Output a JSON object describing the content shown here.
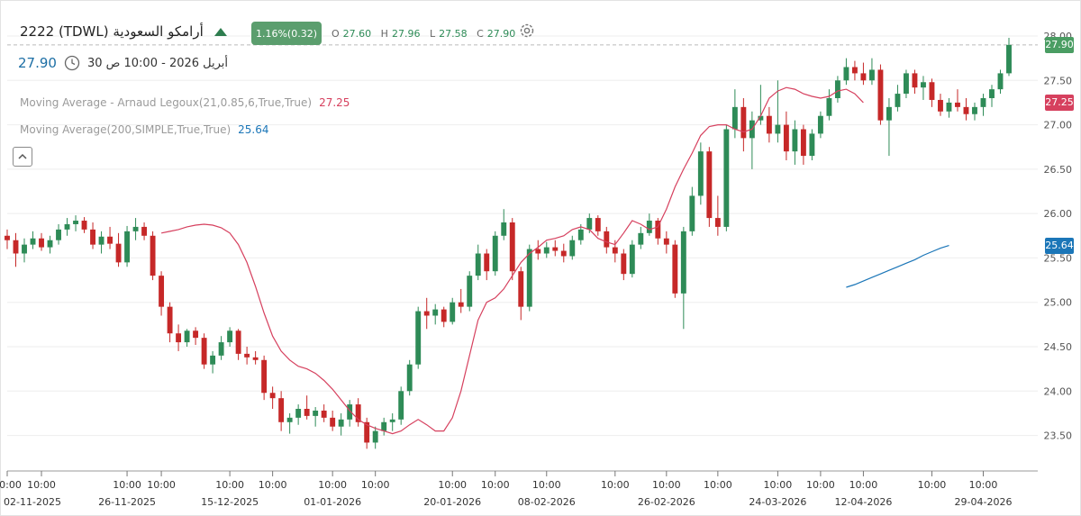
{
  "header": {
    "symbol_label": "2222  (TDWL) أرامكو السعودية",
    "change_badge": "1.16%(0.32)",
    "ohlc": {
      "o_label": "O",
      "o": "27.60",
      "h_label": "H",
      "h": "27.96",
      "l_label": "L",
      "l": "27.58",
      "c_label": "C",
      "c": "27.90"
    },
    "last_price": "27.90",
    "datetime": "30 أبريل 2026 - 10:00 ص",
    "icons": [
      "up-arrow-icon",
      "gear-icon",
      "clock-icon",
      "chevron-up-icon"
    ]
  },
  "indicators": [
    {
      "label": "Moving Average - Arnaud Legoux(21,0.85,6,True,True)",
      "value": "27.25",
      "color": "#d6405e"
    },
    {
      "label": "Moving Average(200,SIMPLE,True,True)",
      "value": "25.64",
      "color": "#1b76b8"
    }
  ],
  "price_tags": {
    "last": "27.90",
    "alma": "27.25",
    "sma": "25.64"
  },
  "colors": {
    "up": "#2e8b57",
    "down": "#c62828",
    "alma": "#d6405e",
    "sma": "#1b76b8",
    "badge": "#5b9e6e"
  },
  "chart_data": {
    "type": "candlestick",
    "ylim": [
      23.1,
      28.0
    ],
    "y_ticks": [
      "23.50",
      "24.00",
      "24.50",
      "25.00",
      "25.50",
      "26.00",
      "26.50",
      "27.00",
      "27.50",
      "28.00"
    ],
    "x_ticks": [
      {
        "time": "10:00",
        "date": "02-11-2025",
        "i": 0
      },
      {
        "time": "10:00",
        "i": 4
      },
      {
        "time": "10:00",
        "date": "26-11-2025",
        "i": 14
      },
      {
        "time": "10:00",
        "i": 18
      },
      {
        "time": "10:00",
        "date": "15-12-2025",
        "i": 26
      },
      {
        "time": "10:00",
        "i": 31
      },
      {
        "time": "10:00",
        "date": "01-01-2026",
        "i": 38
      },
      {
        "time": "10:00",
        "i": 43
      },
      {
        "time": "10:00",
        "date": "20-01-2026",
        "i": 52
      },
      {
        "time": "10:00",
        "i": 57
      },
      {
        "time": "10:00",
        "date": "08-02-2026",
        "i": 63
      },
      {
        "time": "10:00",
        "i": 71
      },
      {
        "time": "10:00",
        "date": "26-02-2026",
        "i": 77
      },
      {
        "time": "10:00",
        "i": 83
      },
      {
        "time": "10:00",
        "date": "24-03-2026",
        "i": 90
      },
      {
        "time": "10:00",
        "i": 95
      },
      {
        "time": "10:00",
        "date": "12-04-2026",
        "i": 100
      },
      {
        "time": "10:00",
        "i": 108
      },
      {
        "time": "10:00",
        "date": "29-04-2026",
        "i": 114
      }
    ],
    "candles": [
      [
        25.75,
        25.82,
        25.6,
        25.7
      ],
      [
        25.7,
        25.78,
        25.4,
        25.55
      ],
      [
        25.55,
        25.72,
        25.45,
        25.65
      ],
      [
        25.65,
        25.8,
        25.6,
        25.72
      ],
      [
        25.72,
        25.78,
        25.58,
        25.62
      ],
      [
        25.62,
        25.75,
        25.55,
        25.7
      ],
      [
        25.7,
        25.88,
        25.65,
        25.82
      ],
      [
        25.82,
        25.95,
        25.75,
        25.88
      ],
      [
        25.88,
        25.98,
        25.8,
        25.92
      ],
      [
        25.92,
        25.96,
        25.78,
        25.82
      ],
      [
        25.82,
        25.9,
        25.6,
        25.65
      ],
      [
        25.65,
        25.8,
        25.55,
        25.74
      ],
      [
        25.74,
        25.85,
        25.6,
        25.66
      ],
      [
        25.66,
        25.78,
        25.4,
        25.45
      ],
      [
        25.45,
        25.86,
        25.4,
        25.8
      ],
      [
        25.8,
        25.95,
        25.7,
        25.85
      ],
      [
        25.85,
        25.9,
        25.7,
        25.75
      ],
      [
        25.75,
        25.8,
        25.25,
        25.3
      ],
      [
        25.3,
        25.35,
        24.85,
        24.95
      ],
      [
        24.95,
        25.0,
        24.55,
        24.65
      ],
      [
        24.65,
        24.75,
        24.45,
        24.55
      ],
      [
        24.55,
        24.7,
        24.5,
        24.68
      ],
      [
        24.68,
        24.72,
        24.52,
        24.6
      ],
      [
        24.6,
        24.65,
        24.25,
        24.3
      ],
      [
        24.3,
        24.45,
        24.2,
        24.4
      ],
      [
        24.4,
        24.62,
        24.35,
        24.55
      ],
      [
        24.55,
        24.72,
        24.5,
        24.68
      ],
      [
        24.68,
        24.7,
        24.35,
        24.42
      ],
      [
        24.42,
        24.5,
        24.3,
        24.38
      ],
      [
        24.38,
        24.45,
        24.3,
        24.35
      ],
      [
        24.35,
        24.4,
        23.9,
        23.98
      ],
      [
        23.98,
        24.05,
        23.8,
        23.92
      ],
      [
        23.92,
        24.0,
        23.55,
        23.65
      ],
      [
        23.65,
        23.75,
        23.52,
        23.7
      ],
      [
        23.7,
        23.85,
        23.62,
        23.8
      ],
      [
        23.8,
        23.95,
        23.68,
        23.72
      ],
      [
        23.72,
        23.82,
        23.6,
        23.78
      ],
      [
        23.78,
        23.85,
        23.65,
        23.7
      ],
      [
        23.7,
        23.78,
        23.55,
        23.6
      ],
      [
        23.6,
        23.75,
        23.5,
        23.68
      ],
      [
        23.68,
        23.9,
        23.6,
        23.85
      ],
      [
        23.85,
        23.92,
        23.6,
        23.65
      ],
      [
        23.65,
        23.7,
        23.35,
        23.42
      ],
      [
        23.42,
        23.6,
        23.35,
        23.55
      ],
      [
        23.55,
        23.7,
        23.5,
        23.65
      ],
      [
        23.65,
        23.75,
        23.55,
        23.68
      ],
      [
        23.68,
        24.05,
        23.62,
        24.0
      ],
      [
        24.0,
        24.35,
        23.95,
        24.3
      ],
      [
        24.3,
        24.95,
        24.25,
        24.9
      ],
      [
        24.9,
        25.05,
        24.7,
        24.85
      ],
      [
        24.85,
        24.98,
        24.75,
        24.92
      ],
      [
        24.92,
        24.95,
        24.72,
        24.78
      ],
      [
        24.78,
        25.05,
        24.75,
        25.0
      ],
      [
        25.0,
        25.15,
        24.88,
        24.95
      ],
      [
        24.95,
        25.35,
        24.9,
        25.3
      ],
      [
        25.3,
        25.65,
        25.25,
        25.55
      ],
      [
        25.55,
        25.6,
        25.25,
        25.35
      ],
      [
        25.35,
        25.8,
        25.3,
        25.75
      ],
      [
        25.75,
        26.05,
        25.7,
        25.9
      ],
      [
        25.9,
        25.95,
        25.25,
        25.35
      ],
      [
        25.35,
        25.4,
        24.8,
        24.95
      ],
      [
        24.95,
        25.65,
        24.9,
        25.6
      ],
      [
        25.6,
        25.7,
        25.48,
        25.55
      ],
      [
        25.55,
        25.68,
        25.5,
        25.62
      ],
      [
        25.62,
        25.7,
        25.52,
        25.58
      ],
      [
        25.58,
        25.66,
        25.45,
        25.52
      ],
      [
        25.52,
        25.75,
        25.48,
        25.7
      ],
      [
        25.7,
        25.88,
        25.65,
        25.82
      ],
      [
        25.82,
        26.0,
        25.78,
        25.95
      ],
      [
        25.95,
        25.98,
        25.75,
        25.8
      ],
      [
        25.8,
        25.85,
        25.55,
        25.62
      ],
      [
        25.62,
        25.7,
        25.45,
        25.55
      ],
      [
        25.55,
        25.6,
        25.25,
        25.32
      ],
      [
        25.32,
        25.7,
        25.28,
        25.65
      ],
      [
        25.65,
        25.85,
        25.6,
        25.78
      ],
      [
        25.78,
        26.0,
        25.75,
        25.92
      ],
      [
        25.92,
        25.95,
        25.65,
        25.72
      ],
      [
        25.72,
        25.8,
        25.55,
        25.65
      ],
      [
        25.65,
        25.7,
        25.05,
        25.1
      ],
      [
        25.1,
        25.85,
        24.7,
        25.8
      ],
      [
        25.8,
        26.3,
        25.75,
        26.2
      ],
      [
        26.2,
        26.8,
        26.1,
        26.7
      ],
      [
        26.7,
        26.75,
        25.85,
        25.95
      ],
      [
        25.95,
        26.2,
        25.75,
        25.85
      ],
      [
        25.85,
        27.0,
        25.8,
        26.95
      ],
      [
        26.95,
        27.4,
        26.85,
        27.2
      ],
      [
        27.2,
        27.3,
        26.7,
        26.85
      ],
      [
        26.85,
        27.15,
        26.5,
        27.05
      ],
      [
        27.05,
        27.45,
        27.0,
        27.1
      ],
      [
        27.1,
        27.2,
        26.8,
        26.9
      ],
      [
        26.9,
        27.5,
        26.8,
        27.0
      ],
      [
        27.0,
        27.15,
        26.6,
        26.7
      ],
      [
        26.7,
        27.05,
        26.55,
        26.95
      ],
      [
        26.95,
        27.0,
        26.55,
        26.65
      ],
      [
        26.65,
        26.95,
        26.6,
        26.9
      ],
      [
        26.9,
        27.15,
        26.85,
        27.1
      ],
      [
        27.1,
        27.4,
        27.05,
        27.3
      ],
      [
        27.3,
        27.55,
        27.25,
        27.5
      ],
      [
        27.5,
        27.75,
        27.45,
        27.65
      ],
      [
        27.65,
        27.72,
        27.5,
        27.58
      ],
      [
        27.58,
        27.7,
        27.45,
        27.5
      ],
      [
        27.5,
        27.75,
        27.45,
        27.62
      ],
      [
        27.62,
        27.68,
        27.0,
        27.05
      ],
      [
        27.05,
        27.3,
        26.65,
        27.2
      ],
      [
        27.2,
        27.45,
        27.15,
        27.35
      ],
      [
        27.35,
        27.62,
        27.3,
        27.58
      ],
      [
        27.58,
        27.62,
        27.35,
        27.42
      ],
      [
        27.42,
        27.55,
        27.28,
        27.48
      ],
      [
        27.48,
        27.52,
        27.2,
        27.28
      ],
      [
        27.28,
        27.35,
        27.1,
        27.15
      ],
      [
        27.15,
        27.3,
        27.08,
        27.25
      ],
      [
        27.25,
        27.4,
        27.15,
        27.2
      ],
      [
        27.2,
        27.3,
        27.05,
        27.12
      ],
      [
        27.12,
        27.25,
        27.05,
        27.2
      ],
      [
        27.2,
        27.35,
        27.1,
        27.3
      ],
      [
        27.3,
        27.45,
        27.2,
        27.4
      ],
      [
        27.4,
        27.62,
        27.35,
        27.58
      ],
      [
        27.58,
        27.98,
        27.55,
        27.9
      ]
    ],
    "alma": [
      25.78,
      25.8,
      25.82,
      25.85,
      25.87,
      25.88,
      25.87,
      25.84,
      25.78,
      25.65,
      25.45,
      25.18,
      24.88,
      24.62,
      24.45,
      24.35,
      24.28,
      24.25,
      24.2,
      24.12,
      24.02,
      23.9,
      23.78,
      23.68,
      23.62,
      23.58,
      23.55,
      23.52,
      23.55,
      23.62,
      23.68,
      23.62,
      23.55,
      23.55,
      23.7,
      24.0,
      24.4,
      24.8,
      25.0,
      25.05,
      25.15,
      25.3,
      25.45,
      25.55,
      25.62,
      25.7,
      25.72,
      25.75,
      25.82,
      25.85,
      25.82,
      25.72,
      25.68,
      25.65,
      25.78,
      25.92,
      25.88,
      25.82,
      25.85,
      26.05,
      26.3,
      26.5,
      26.68,
      26.88,
      26.98,
      27.0,
      27.0,
      26.95,
      26.92,
      26.95,
      27.1,
      27.3,
      27.38,
      27.42,
      27.4,
      27.35,
      27.32,
      27.3,
      27.32,
      27.38,
      27.4,
      27.35,
      27.25
    ],
    "alma_start": 18,
    "sma": [
      25.17,
      25.2,
      25.24,
      25.28,
      25.32,
      25.36,
      25.4,
      25.44,
      25.48,
      25.53,
      25.57,
      25.61,
      25.64
    ],
    "sma_start": 98
  }
}
